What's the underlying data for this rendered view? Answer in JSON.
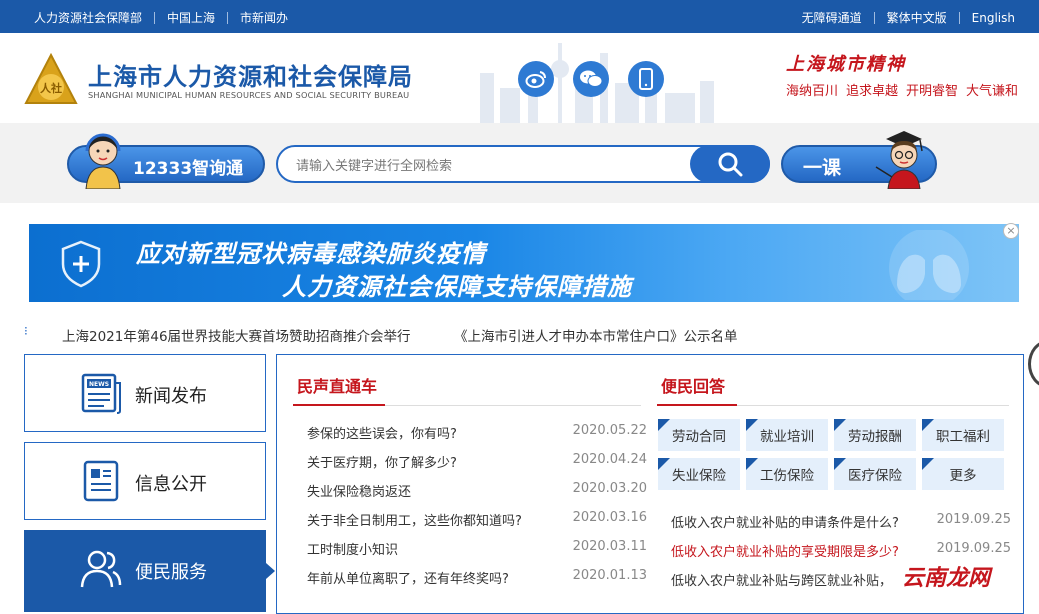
{
  "topbar": {
    "left_links": [
      "人力资源社会保障部",
      "中国上海",
      "市新闻办"
    ],
    "right_links": [
      "无障碍通道",
      "繁体中文版",
      "English"
    ],
    "bg": "#1b59a8"
  },
  "header": {
    "title_cn": "上海市人力资源和社会保障局",
    "title_en": "SHANGHAI MUNICIPAL HUMAN RESOURCES AND SOCIAL SECURITY BUREAU",
    "logo_icon": "bureau-logo-icon",
    "social_icons": [
      "weibo-icon",
      "wechat-icon",
      "mobile-icon"
    ],
    "spirit_title": "上海城市精神",
    "spirit_items": [
      "海纳百川",
      "追求卓越",
      "开明睿智",
      "大气谦和"
    ]
  },
  "search": {
    "assistant_label": "12333智询通",
    "placeholder": "请输入关键字进行全网检索",
    "value": "",
    "yike_label": "一课"
  },
  "banner": {
    "line1": "应对新型冠状病毒感染肺炎疫情",
    "line2": "人力资源社会保障支持保障措施",
    "close": "×"
  },
  "ticker": {
    "items": [
      "上海2021年第46届世界技能大赛首场赞助招商推介会举行",
      "《上海市引进人才申办本市常住户口》公示名单"
    ]
  },
  "sidebar": {
    "items": [
      {
        "label": "新闻发布",
        "icon": "news-icon"
      },
      {
        "label": "信息公开",
        "icon": "document-icon"
      },
      {
        "label": "便民服务",
        "icon": "people-icon"
      }
    ],
    "active": 2
  },
  "minsheng": {
    "title": "民声直通车",
    "items": [
      {
        "text": "参保的这些误会，你有吗?",
        "date": "2020.05.22"
      },
      {
        "text": "关于医疗期，你了解多少?",
        "date": "2020.04.24"
      },
      {
        "text": "失业保险稳岗返还",
        "date": "2020.03.20"
      },
      {
        "text": "关于非全日制用工，这些你都知道吗?",
        "date": "2020.03.16"
      },
      {
        "text": "工时制度小知识",
        "date": "2020.03.11"
      },
      {
        "text": "年前从单位离职了，还有年终奖吗?",
        "date": "2020.01.13"
      }
    ]
  },
  "bianmin": {
    "title": "便民回答",
    "categories": [
      "劳动合同",
      "就业培训",
      "劳动报酬",
      "职工福利",
      "失业保险",
      "工伤保险",
      "医疗保险",
      "更多"
    ],
    "items": [
      {
        "text": "低收入农户就业补贴的申请条件是什么?",
        "date": "2019.09.25"
      },
      {
        "text": "低收入农户就业补贴的享受期限是多少?",
        "date": "2019.09.25"
      },
      {
        "text": "低收入农户就业补贴与跨区就业补贴，",
        "date": ""
      }
    ]
  },
  "watermark": "云南龙网",
  "colors": {
    "primary": "#1b59a8",
    "accent": "#c5161d",
    "button_bg": "#e4effb"
  }
}
